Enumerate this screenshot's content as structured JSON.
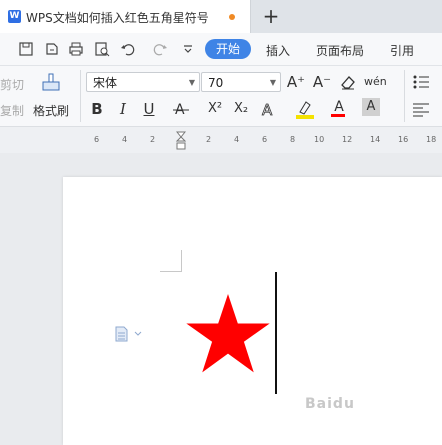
{
  "tab": {
    "title": "WPS文档如何插入红色五角星符号",
    "logo": "W",
    "new_tab": "+"
  },
  "menu": {
    "start": "开始",
    "insert": "插入",
    "layout": "页面布局",
    "reference": "引用"
  },
  "ribbon": {
    "cut": "剪切",
    "copy": "复制",
    "format_painter": "格式刷",
    "font_name": "宋体",
    "font_size": "70",
    "grow_font": "A⁺",
    "shrink_font": "A⁻",
    "bold": "B",
    "italic": "I",
    "underline": "U",
    "superscript": "X²",
    "subscript": "X₂",
    "phonetic": "wén",
    "font_color_letter": "A"
  },
  "ruler": {
    "ticks": [
      "6",
      "4",
      "2",
      "2",
      "4",
      "6",
      "8",
      "10",
      "12",
      "14",
      "16",
      "18"
    ]
  },
  "watermark": "Baidu",
  "colors": {
    "accent": "#3f84e6",
    "star": "#ff0000",
    "tab_dot": "#f08a24"
  }
}
